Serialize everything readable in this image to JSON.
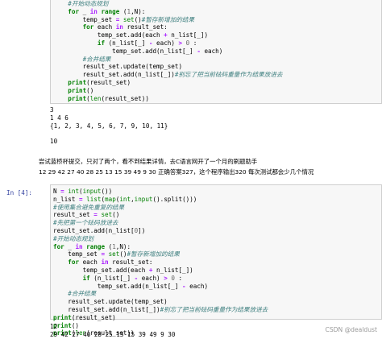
{
  "cell1": {
    "code_lines": [
      "    #开始动态规划",
      "    for _ in range (1,N):",
      "        temp_set = set()#暂存新增加的结果",
      "        for each in result_set:",
      "            temp_set.add(each + n_list[_])",
      "            if (n_list[_] - each) > 0 :",
      "                temp_set.add(n_list[_] - each)",
      "        #合并结果",
      "        result_set.update(temp_set)",
      "        result_set.add(n_list[_])#别忘了把当前砝码重量作为结果放进去",
      "    print(result_set)",
      "    print()",
      "    print(len(result_set))"
    ],
    "output_lines": [
      "3",
      "1 4 6",
      "{1, 2, 3, 4, 5, 6, 7, 9, 10, 11}",
      "",
      "10"
    ]
  },
  "markdown": {
    "line1": "尝试蓝桥杯提交，只对了两个，看不到结果详情，去C语言网开了一个月的刷题助手",
    "line2": "12 29 42 27 40 28 25 13 15 39 49 9 30 正确答案327，这个程序输出320 每次测试都会少几个情况"
  },
  "cell2": {
    "prompt": "In  [4]:",
    "code_lines": [
      "N = int(input())",
      "n_list = list(map(int,input().split()))",
      "#使用集合避免重复的结果",
      "result_set = set()",
      "#先把第一个砝码放进去",
      "result_set.add(n_list[0])",
      "#开始动态规划",
      "for _ in range (1,N):",
      "    temp_set = set()#暂存新增加的结果",
      "    for each in result_set:",
      "        temp_set.add(each + n_list[_])",
      "        if (n_list[_] - each) > 0 :",
      "            temp_set.add(n_list[_] - each)",
      "    #合并结果",
      "    result_set.update(temp_set)",
      "    result_set.add(n_list[_])#别忘了把当前砝码重量作为结果放进去",
      "print(result_set)",
      "print()",
      "print(len(result_set))"
    ],
    "output_lines": [
      "12",
      "29 42 27 40 28 25 13 15 39 49 9 30"
    ]
  },
  "watermark": "CSDN @dealdust"
}
